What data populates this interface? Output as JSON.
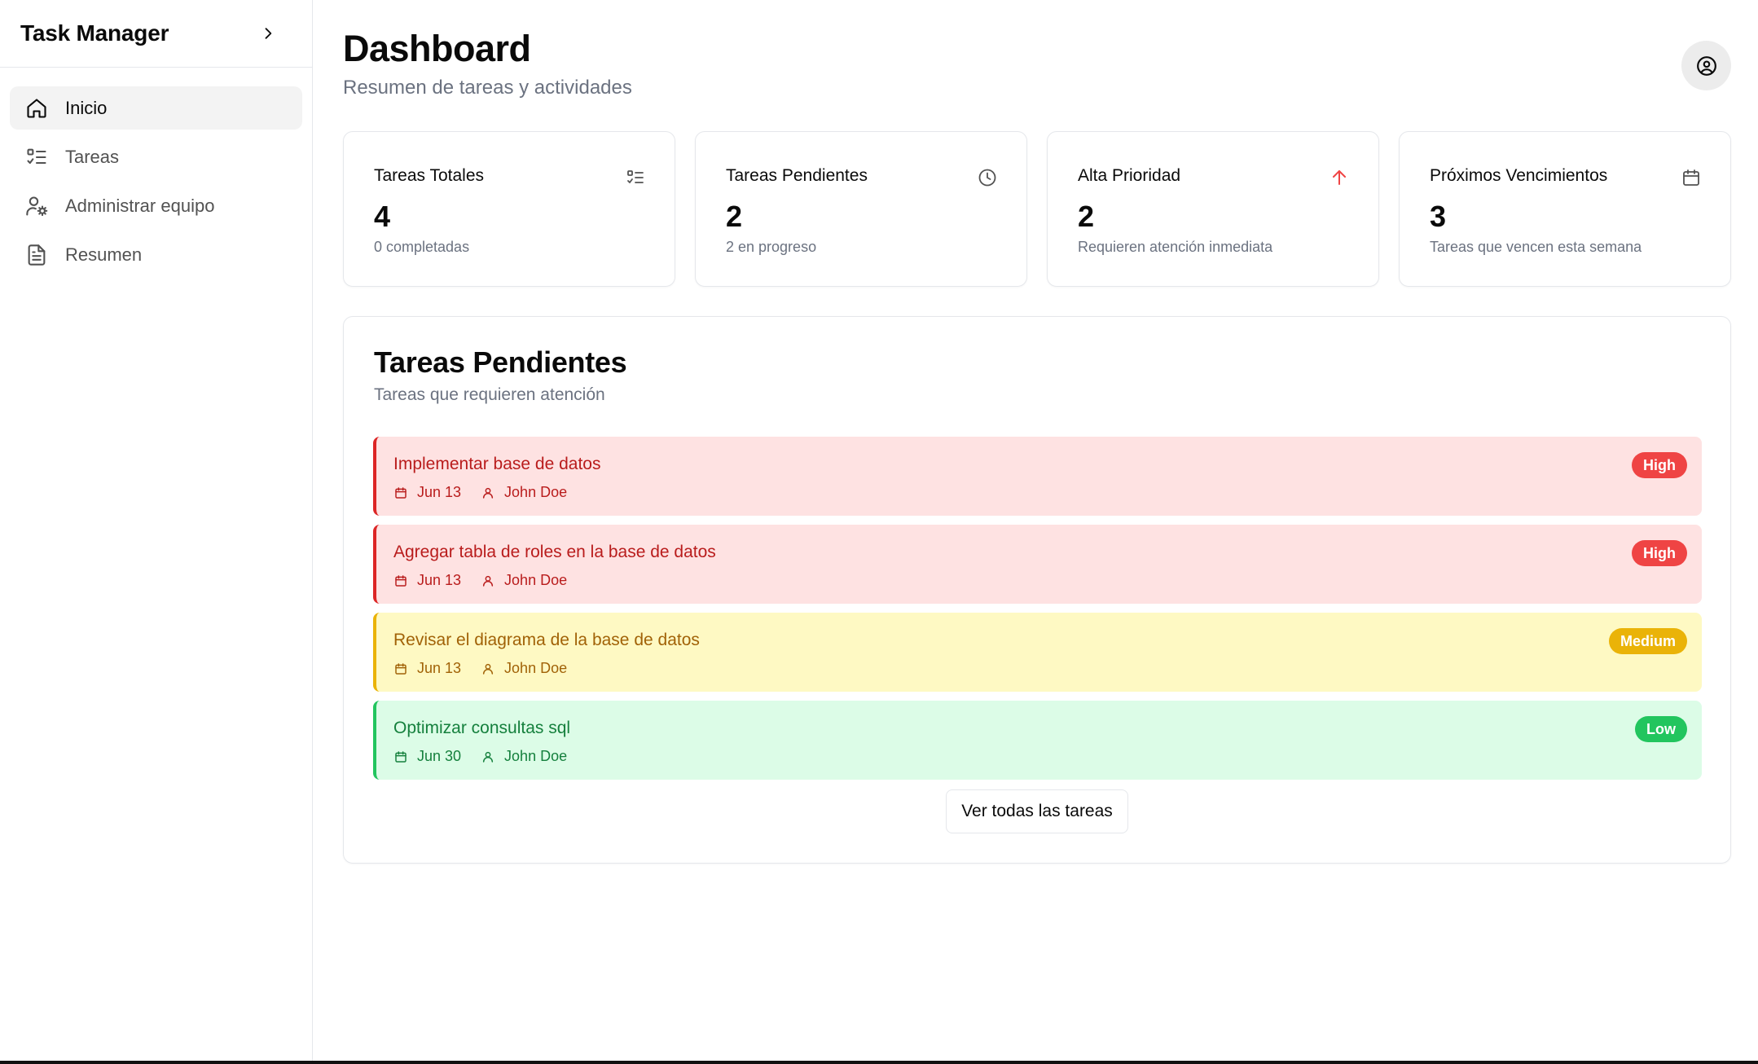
{
  "sidebar": {
    "app_title": "Task Manager",
    "items": [
      {
        "label": "Inicio",
        "icon": "home-icon",
        "active": true
      },
      {
        "label": "Tareas",
        "icon": "list-check-icon",
        "active": false
      },
      {
        "label": "Administrar equipo",
        "icon": "user-cog-icon",
        "active": false
      },
      {
        "label": "Resumen",
        "icon": "document-icon",
        "active": false
      }
    ]
  },
  "header": {
    "title": "Dashboard",
    "subtitle": "Resumen de tareas y actividades"
  },
  "stats": [
    {
      "title": "Tareas Totales",
      "value": "4",
      "note": "0 completadas",
      "icon": "list-check-icon"
    },
    {
      "title": "Tareas Pendientes",
      "value": "2",
      "note": "2 en progreso",
      "icon": "clock-icon"
    },
    {
      "title": "Alta Prioridad",
      "value": "2",
      "note": "Requieren atención inmediata",
      "icon": "arrow-up-icon",
      "icon_color": "#ef4444"
    },
    {
      "title": "Próximos Vencimientos",
      "value": "3",
      "note": "Tareas que vencen esta semana",
      "icon": "calendar-icon"
    }
  ],
  "pending": {
    "title": "Tareas Pendientes",
    "subtitle": "Tareas que requieren atención",
    "tasks": [
      {
        "title": "Implementar base de datos",
        "date": "Jun 13",
        "assignee": "John Doe",
        "priority": "High"
      },
      {
        "title": "Agregar tabla de roles en la base de datos",
        "date": "Jun 13",
        "assignee": "John Doe",
        "priority": "High"
      },
      {
        "title": "Revisar el diagrama de la base de datos",
        "date": "Jun 13",
        "assignee": "John Doe",
        "priority": "Medium"
      },
      {
        "title": "Optimizar consultas sql",
        "date": "Jun 30",
        "assignee": "John Doe",
        "priority": "Low"
      }
    ],
    "view_all_label": "Ver todas las tareas"
  },
  "colors": {
    "high": "#ef4444",
    "medium": "#eab308",
    "low": "#22c55e"
  }
}
